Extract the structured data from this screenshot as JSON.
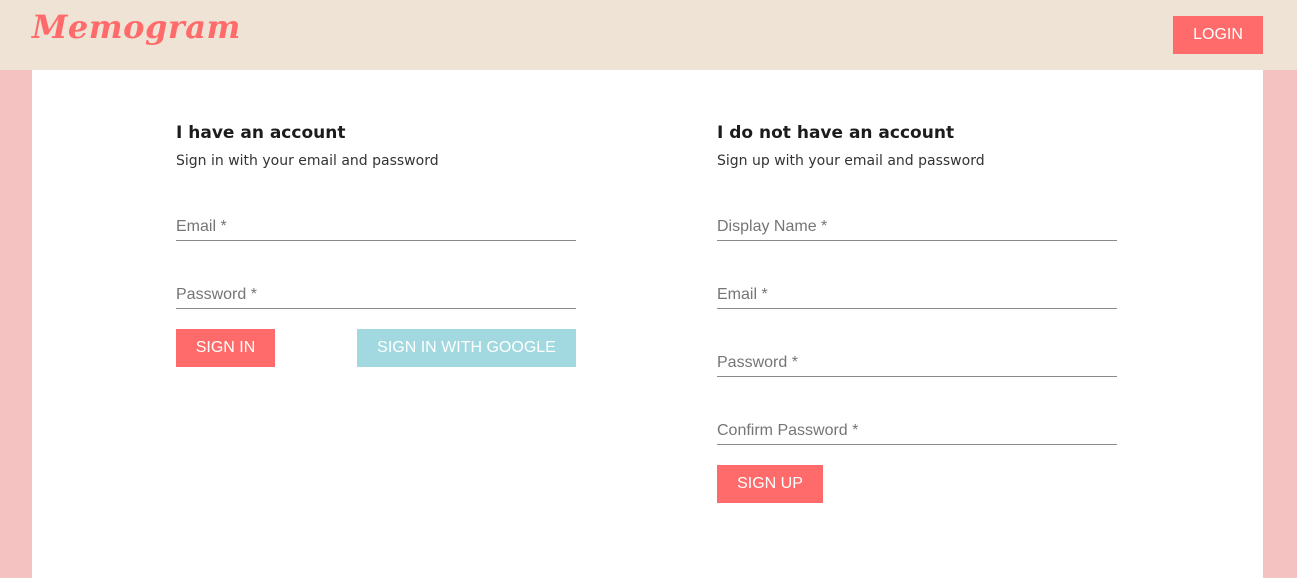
{
  "header": {
    "logo": "Memogram",
    "login_label": "LOGIN"
  },
  "signin": {
    "title": "I have an account",
    "subtitle": "Sign in with your email and password",
    "email_placeholder": "Email *",
    "password_placeholder": "Password *",
    "signin_label": "SIGN IN",
    "google_label": "SIGN IN WITH GOOGLE"
  },
  "signup": {
    "title": "I do not have an account",
    "subtitle": "Sign up with your email and password",
    "display_name_placeholder": "Display Name *",
    "email_placeholder": "Email *",
    "password_placeholder": "Password *",
    "confirm_password_placeholder": "Confirm Password *",
    "signup_label": "SIGN UP"
  },
  "colors": {
    "accent": "#ff6b6b",
    "google": "#a2d8e0",
    "header_bg": "#efe3d6",
    "page_bg": "#f5c2c2"
  }
}
